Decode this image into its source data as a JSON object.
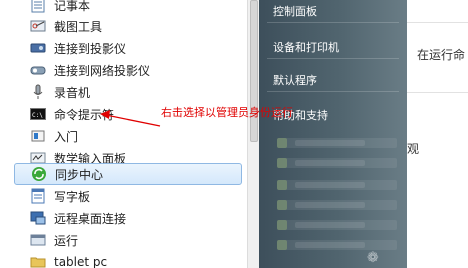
{
  "program_list": [
    {
      "label": "记事本",
      "icon": "notepad-icon"
    },
    {
      "label": "截图工具",
      "icon": "snipping-tool-icon"
    },
    {
      "label": "连接到投影仪",
      "icon": "projector-icon"
    },
    {
      "label": "连接到网络投影仪",
      "icon": "network-projector-icon"
    },
    {
      "label": "录音机",
      "icon": "microphone-icon"
    },
    {
      "label": "命令提示符",
      "icon": "command-prompt-icon"
    },
    {
      "label": "入门",
      "icon": "getting-started-icon"
    },
    {
      "label": "数学输入面板",
      "icon": "math-input-icon"
    },
    {
      "label": "同步中心",
      "icon": "sync-center-icon",
      "selected": true
    },
    {
      "label": "写字板",
      "icon": "wordpad-icon"
    },
    {
      "label": "远程桌面连接",
      "icon": "remote-desktop-icon"
    },
    {
      "label": "运行",
      "icon": "run-icon"
    },
    {
      "label": "tablet pc",
      "icon": "folder-icon"
    }
  ],
  "right_menu": [
    {
      "label": "控制面板"
    },
    {
      "label": "设备和打印机"
    },
    {
      "label": "默认程序"
    },
    {
      "label": "帮助和支持"
    }
  ],
  "background_window": {
    "text1": "在运行命",
    "text2": "观"
  },
  "annotation": {
    "text": "右击选择以管理员身份运行",
    "color": "#e00000"
  }
}
